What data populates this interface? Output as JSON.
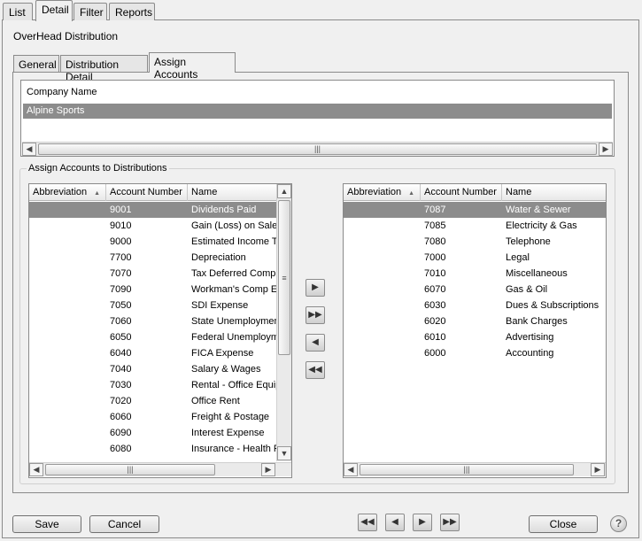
{
  "tabs": [
    "List",
    "Detail",
    "Filter",
    "Reports"
  ],
  "section_title": "OverHead Distribution",
  "sub_tabs": [
    "General",
    "Distribution Detail",
    "Assign Accounts"
  ],
  "company": {
    "header": "Company Name",
    "rows": [
      "Alpine Sports"
    ]
  },
  "assign_group_label": "Assign Accounts to Distributions",
  "columns": [
    "Abbreviation",
    "Account Number",
    "Name"
  ],
  "available_accounts": [
    {
      "abbr": "",
      "number": "9001",
      "name": "Dividends Paid"
    },
    {
      "abbr": "",
      "number": "9010",
      "name": "Gain (Loss) on Sale o"
    },
    {
      "abbr": "",
      "number": "9000",
      "name": "Estimated Income Ta"
    },
    {
      "abbr": "",
      "number": "7700",
      "name": "Depreciation"
    },
    {
      "abbr": "",
      "number": "7070",
      "name": "Tax Deferred Comp"
    },
    {
      "abbr": "",
      "number": "7090",
      "name": "Workman's Comp Ex"
    },
    {
      "abbr": "",
      "number": "7050",
      "name": "SDI Expense"
    },
    {
      "abbr": "",
      "number": "7060",
      "name": "State Unemploymen"
    },
    {
      "abbr": "",
      "number": "6050",
      "name": "Federal Unemployme"
    },
    {
      "abbr": "",
      "number": "6040",
      "name": "FICA Expense"
    },
    {
      "abbr": "",
      "number": "7040",
      "name": "Salary & Wages"
    },
    {
      "abbr": "",
      "number": "7030",
      "name": "Rental - Office Equip"
    },
    {
      "abbr": "",
      "number": "7020",
      "name": "Office Rent"
    },
    {
      "abbr": "",
      "number": "6060",
      "name": "Freight & Postage"
    },
    {
      "abbr": "",
      "number": "6090",
      "name": "Interest Expense"
    },
    {
      "abbr": "",
      "number": "6080",
      "name": "Insurance - Health P"
    }
  ],
  "assigned_accounts": [
    {
      "abbr": "",
      "number": "7087",
      "name": "Water & Sewer"
    },
    {
      "abbr": "",
      "number": "7085",
      "name": "Electricity & Gas"
    },
    {
      "abbr": "",
      "number": "7080",
      "name": "Telephone"
    },
    {
      "abbr": "",
      "number": "7000",
      "name": "Legal"
    },
    {
      "abbr": "",
      "number": "7010",
      "name": "Miscellaneous"
    },
    {
      "abbr": "",
      "number": "6070",
      "name": "Gas & Oil"
    },
    {
      "abbr": "",
      "number": "6030",
      "name": "Dues & Subscriptions"
    },
    {
      "abbr": "",
      "number": "6020",
      "name": "Bank Charges"
    },
    {
      "abbr": "",
      "number": "6010",
      "name": "Advertising"
    },
    {
      "abbr": "",
      "number": "6000",
      "name": "Accounting"
    }
  ],
  "buttons": {
    "save": "Save",
    "cancel": "Cancel",
    "close": "Close",
    "help": "?"
  },
  "icons": {
    "move_right": "arrow-right-icon",
    "move_all_right": "double-arrow-right-icon",
    "move_left": "arrow-left-icon",
    "move_all_left": "double-arrow-left-icon",
    "nav_first": "first-record-icon",
    "nav_prev": "previous-record-icon",
    "nav_next": "next-record-icon",
    "nav_last": "last-record-icon"
  },
  "colors": {
    "selection": "#8c8c8c",
    "panel": "#f0f0f0"
  }
}
